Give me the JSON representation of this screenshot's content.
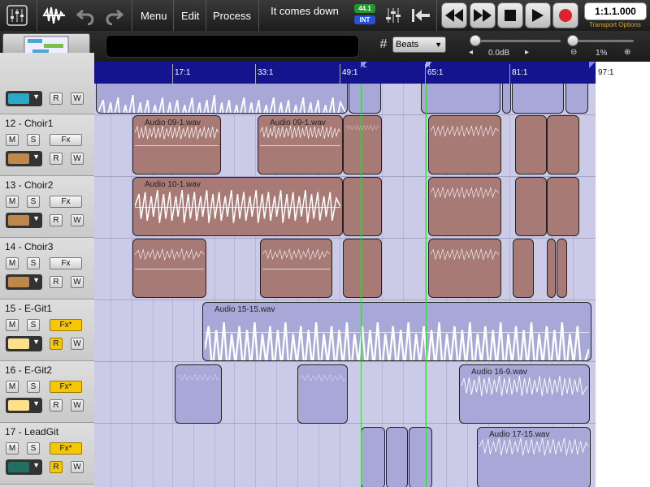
{
  "toolbar": {
    "menu_label": "Menu",
    "edit_label": "Edit",
    "process_label": "Process",
    "song_title": "It comes down",
    "sample_rate": "44.1",
    "sync_mode": "INT",
    "counter": "1:1.1.000",
    "transport_options": "Transport Options"
  },
  "secondbar": {
    "snap_value": "Beats",
    "volume": "0.0dB",
    "zoom": "1%"
  },
  "ruler": {
    "labels": [
      "17:1",
      "33:1",
      "49:1",
      "65:1",
      "81:1",
      "97:1"
    ],
    "markers": [
      "L",
      "R"
    ]
  },
  "tracks": [
    {
      "name": "12 - Choir1",
      "mute": "M",
      "solo": "S",
      "fx": "Fx",
      "fx_on": false,
      "rec": "R",
      "write": "W",
      "rec_on": false,
      "color": "#c0874a"
    },
    {
      "name": "13 - Choir2",
      "mute": "M",
      "solo": "S",
      "fx": "Fx",
      "fx_on": false,
      "rec": "R",
      "write": "W",
      "rec_on": false,
      "color": "#c0874a"
    },
    {
      "name": "14 - Choir3",
      "mute": "M",
      "solo": "S",
      "fx": "Fx",
      "fx_on": false,
      "rec": "R",
      "write": "W",
      "rec_on": false,
      "color": "#c0874a"
    },
    {
      "name": "15 - E-Git1",
      "mute": "M",
      "solo": "S",
      "fx": "Fx*",
      "fx_on": true,
      "rec": "R",
      "write": "W",
      "rec_on": true,
      "color": "#ffe08a"
    },
    {
      "name": "16 - E-Git2",
      "mute": "M",
      "solo": "S",
      "fx": "Fx*",
      "fx_on": true,
      "rec": "R",
      "write": "W",
      "rec_on": false,
      "color": "#ffe08a"
    },
    {
      "name": "17 - LeadGit",
      "mute": "M",
      "solo": "S",
      "fx": "Fx*",
      "fx_on": true,
      "rec": "R",
      "write": "W",
      "rec_on": true,
      "color": "#1f6f63"
    }
  ],
  "partial_track": {
    "rec": "R",
    "write": "W",
    "color": "#2aa8c8"
  },
  "clips": [
    "Audio 09-1.wav",
    "Audio 09-1.wav",
    "Audio 10-1.wav",
    "Audio 15-15.wav",
    "Audio 16-9.wav",
    "Audio 17-15.wav"
  ],
  "colors": {
    "ruler_bg": "#14148e",
    "clip_brown": "#a77a76",
    "clip_blue": "#a7a7d8",
    "playhead": "#3ad43a",
    "record": "#e0202a"
  }
}
